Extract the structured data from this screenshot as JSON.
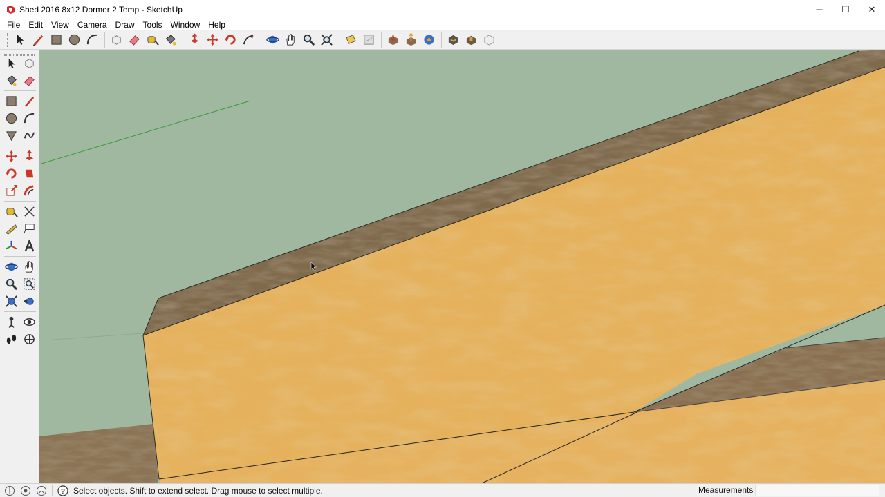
{
  "window": {
    "title": "Shed 2016 8x12 Dormer 2 Temp - SketchUp",
    "minimize_glyph": "─",
    "maximize_glyph": "☐",
    "close_glyph": "✕"
  },
  "menu": [
    "File",
    "Edit",
    "View",
    "Camera",
    "Draw",
    "Tools",
    "Window",
    "Help"
  ],
  "toolbar_top": [
    "select-icon",
    "pencil-line-icon",
    "rectangle-icon",
    "circle-icon",
    "arc-icon",
    "make-component-icon",
    "eraser-icon",
    "tape-measure-icon",
    "paint-bucket-icon",
    "push-pull-icon",
    "move-icon",
    "rotate-icon",
    "follow-me-icon",
    "orbit-icon",
    "pan-icon",
    "zoom-icon",
    "zoom-extents-icon",
    "section-plane-icon",
    "layout-doc-icon",
    "get-models-icon",
    "share-model-icon",
    "extension-warehouse-icon",
    "preview-3d-icon",
    "warehouse-share-icon",
    "send-to-layout-icon"
  ],
  "toolbar_left": [
    "select-icon",
    "make-component-icon",
    "paint-bucket-icon",
    "eraser-icon",
    "rectangle-icon",
    "pencil-line-icon",
    "circle-icon",
    "arc-icon",
    "polygon-icon",
    "freehand-icon",
    "move-icon",
    "push-pull-icon",
    "rotate-icon",
    "follow-me-icon",
    "scale-icon",
    "offset-icon",
    "tape-measure-icon",
    "dimension-icon",
    "protractor-icon",
    "text-icon",
    "axes-icon",
    "3d-text-icon",
    "orbit-icon",
    "pan-icon",
    "zoom-icon",
    "zoom-window-icon",
    "zoom-extents-icon",
    "previous-view-icon",
    "position-camera-icon",
    "look-around-icon",
    "walk-icon",
    "section-plane-icon"
  ],
  "status": {
    "message": "Select objects. Shift to extend select. Drag mouse to select multiple.",
    "measurements_label": "Measurements",
    "measurements_value": ""
  },
  "colors": {
    "sky": "#9fb89f",
    "osb_light": "#e5b15c",
    "osb_dark": "#c58a32",
    "edge_brown": "#7a6444",
    "axis_green": "#3e9a3e"
  }
}
